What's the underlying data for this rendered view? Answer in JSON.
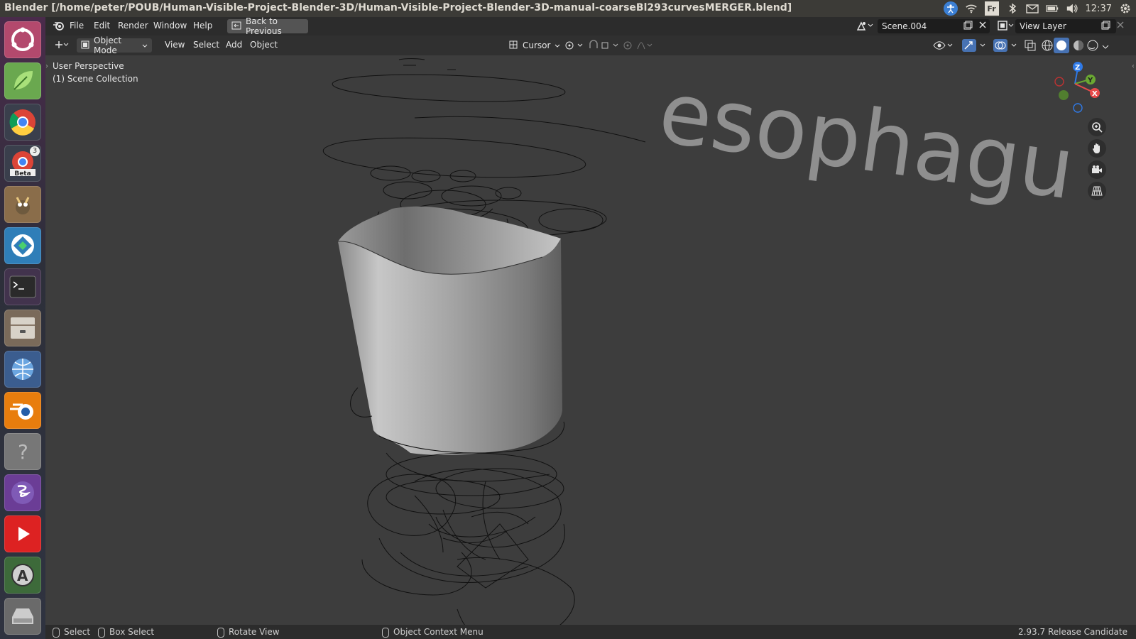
{
  "window": {
    "title": "Blender [/home/peter/POUB/Human-Visible-Project-Blender-3D/Human-Visible-Project-Blender-3D-manual-coarseBl293curvesMERGER.blend]"
  },
  "tray": {
    "keyboard_label": "Fr",
    "time": "12:37"
  },
  "launcher": {
    "badge_count": "3",
    "beta_label": "Beta"
  },
  "menubar": {
    "items": [
      "File",
      "Edit",
      "Render",
      "Window",
      "Help"
    ],
    "back_button": "Back to Previous",
    "scene": "Scene.004",
    "view_layer": "View Layer"
  },
  "toolbar": {
    "mode": "Object Mode",
    "items": [
      "View",
      "Select",
      "Add",
      "Object"
    ],
    "pivot": "Cursor"
  },
  "viewport": {
    "perspective": "User Perspective",
    "collection": "(1) Scene Collection",
    "label_3d": "esophagu",
    "gizmo": {
      "z": "Z",
      "y": "Y",
      "x": "X"
    }
  },
  "statusbar": {
    "select": "Select",
    "box_select": "Box Select",
    "rotate": "Rotate View",
    "context": "Object Context Menu",
    "version": "2.93.7 Release Candidate"
  },
  "colors": {
    "accent_orange": "#e87d0d",
    "viewport_bg": "#3d3d3d",
    "panel": "#3c3b37"
  }
}
